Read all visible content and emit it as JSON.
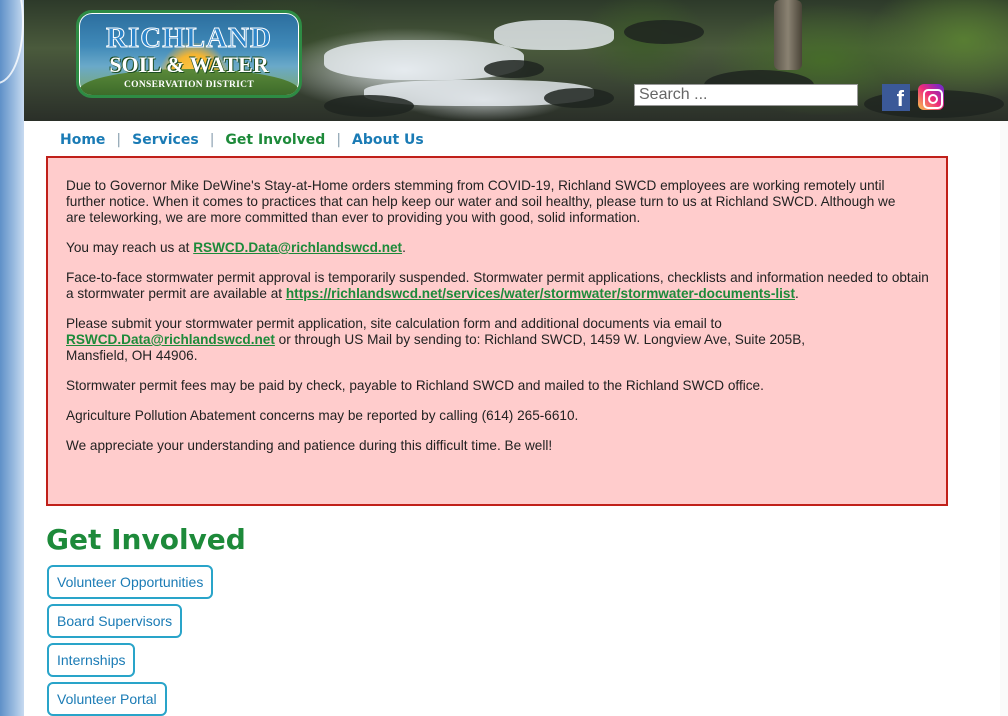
{
  "logo": {
    "line1": "RICHLAND",
    "line2": "SOIL & WATER",
    "line3": "CONSERVATION DISTRICT"
  },
  "search": {
    "placeholder": "Search ..."
  },
  "social": {
    "facebook": "f"
  },
  "nav": {
    "items": [
      {
        "label": "Home"
      },
      {
        "label": "Services"
      },
      {
        "label": "Get Involved"
      },
      {
        "label": "About Us"
      }
    ],
    "separator": "|"
  },
  "notice": {
    "p1": "Due to Governor Mike DeWine's Stay-at-Home orders stemming from COVID-19, Richland SWCD employees are working remotely until further notice. When it comes to practices that can help keep our water and soil healthy, please turn to us at Richland SWCD. Although we are teleworking, we are more committed than ever to providing you with good, solid information.",
    "p2_text": "You may reach us at ",
    "p2_link": "RSWCD.Data@richlandswcd.net",
    "p2_end": ".",
    "p3_text": "Face-to-face stormwater permit approval is temporarily suspended. Stormwater permit applications, checklists and information needed to obtain a stormwater permit are available at ",
    "p3_link": "https://richlandswcd.net/services/water/stormwater/stormwater-documents-list",
    "p3_end": ".",
    "p4_text": "Please submit your stormwater permit application, site calculation form and additional documents via email to ",
    "p4_link": "RSWCD.Data@richlandswcd.net",
    "p4_text2": " or through US Mail by sending to: Richland SWCD, 1459 W. Longview Ave, Suite 205B, Mansfield, OH  44906.",
    "p5": "Stormwater permit fees may be paid by check, payable to Richland SWCD and mailed to the Richland SWCD office.",
    "p6": "Agriculture Pollution Abatement concerns may be reported by calling (614) 265-6610.",
    "p7": "We appreciate your understanding and patience during this difficult time. Be well!"
  },
  "section": {
    "title": "Get Involved",
    "links": [
      {
        "label": "Volunteer Opportunities"
      },
      {
        "label": "Board Supervisors"
      },
      {
        "label": "Internships"
      },
      {
        "label": "Volunteer Portal"
      }
    ]
  },
  "colors": {
    "nav_link": "#1a7bb5",
    "nav_active": "#1d8a3a",
    "notice_bg": "#ffcccc",
    "notice_border": "#c0201a",
    "heading_green": "#1d8a3a",
    "button_border": "#29a4c9"
  }
}
